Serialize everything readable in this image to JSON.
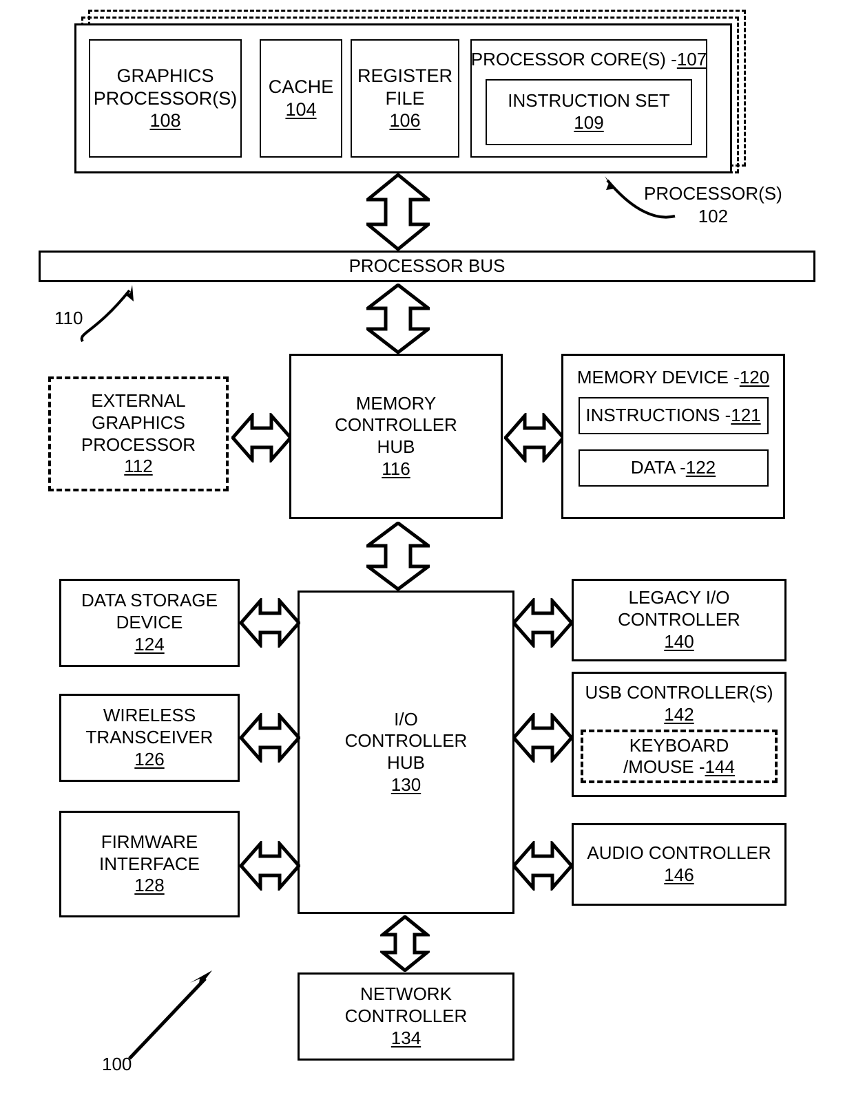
{
  "figure": {
    "figure_ref": "100",
    "processor_group": {
      "callout_label": "PROCESSOR(S)",
      "callout_number": "102",
      "blocks": [
        {
          "name": "graphics-processors",
          "lines": [
            "GRAPHICS",
            "PROCESSOR(S)"
          ],
          "number": "108"
        },
        {
          "name": "cache",
          "lines": [
            "CACHE"
          ],
          "number": "104"
        },
        {
          "name": "register-file",
          "lines": [
            "REGISTER",
            "FILE"
          ],
          "number": "106"
        },
        {
          "name": "processor-cores",
          "title": "PROCESSOR CORE(S) - ",
          "number": "107",
          "inner": {
            "name": "instruction-set",
            "lines": [
              "INSTRUCTION SET"
            ],
            "number": "109"
          }
        }
      ]
    },
    "processor_bus": {
      "label": "PROCESSOR BUS",
      "callout_number": "110"
    },
    "external_graphics_processor": {
      "lines": [
        "EXTERNAL",
        "GRAPHICS",
        "PROCESSOR"
      ],
      "number": "112",
      "style": "dashed"
    },
    "memory_controller_hub": {
      "lines": [
        "MEMORY",
        "CONTROLLER",
        "HUB"
      ],
      "number": "116"
    },
    "memory_device": {
      "title": "MEMORY DEVICE - ",
      "number": "120",
      "children": [
        {
          "name": "instructions",
          "title": "INSTRUCTIONS - ",
          "number": "121"
        },
        {
          "name": "data",
          "title": "DATA - ",
          "number": "122"
        }
      ]
    },
    "io_controller_hub": {
      "lines": [
        "I/O",
        "CONTROLLER",
        "HUB"
      ],
      "number": "130"
    },
    "left_peripherals": [
      {
        "name": "data-storage-device",
        "lines": [
          "DATA STORAGE",
          "DEVICE"
        ],
        "number": "124"
      },
      {
        "name": "wireless-transceiver",
        "lines": [
          "WIRELESS",
          "TRANSCEIVER"
        ],
        "number": "126"
      },
      {
        "name": "firmware-interface",
        "lines": [
          "FIRMWARE",
          "INTERFACE"
        ],
        "number": "128"
      }
    ],
    "right_peripherals": [
      {
        "name": "legacy-io-controller",
        "lines": [
          "LEGACY I/O",
          "CONTROLLER"
        ],
        "number": "140"
      },
      {
        "name": "usb-controllers",
        "lines": [
          "USB CONTROLLER(S)"
        ],
        "number": "142",
        "inner": {
          "name": "keyboard-mouse",
          "title_line1": "KEYBOARD",
          "title_line2": "/MOUSE - ",
          "number": "144",
          "style": "dashed"
        }
      },
      {
        "name": "audio-controller",
        "lines": [
          "AUDIO CONTROLLER"
        ],
        "number": "146"
      }
    ],
    "network_controller": {
      "lines": [
        "NETWORK",
        "CONTROLLER"
      ],
      "number": "134"
    },
    "colors": {
      "stroke": "#000000",
      "background": "#ffffff"
    }
  }
}
